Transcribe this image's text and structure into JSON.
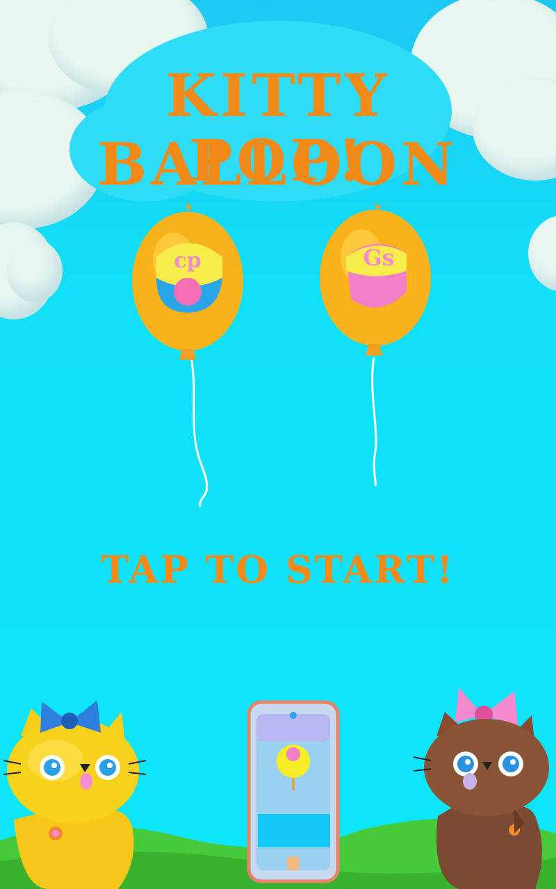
{
  "title": {
    "line1": "KITTY BALLOON",
    "line2": "POP!"
  },
  "tap_to_start": "TAP TO START!",
  "balloons": [
    {
      "color": "yellow-orange",
      "decal": "pink-blue"
    },
    {
      "color": "yellow-orange",
      "decal": "pink"
    }
  ],
  "cats": [
    {
      "fur": "yellow",
      "bow": "blue"
    },
    {
      "fur": "brown",
      "bow": "pink"
    }
  ],
  "phone_hint": {
    "icon": "phone-tap-icon"
  },
  "colors": {
    "title": "#f28a1a",
    "sky": "#12e0f8",
    "balloon": "#f7b21c",
    "grass": "#46c93a"
  }
}
